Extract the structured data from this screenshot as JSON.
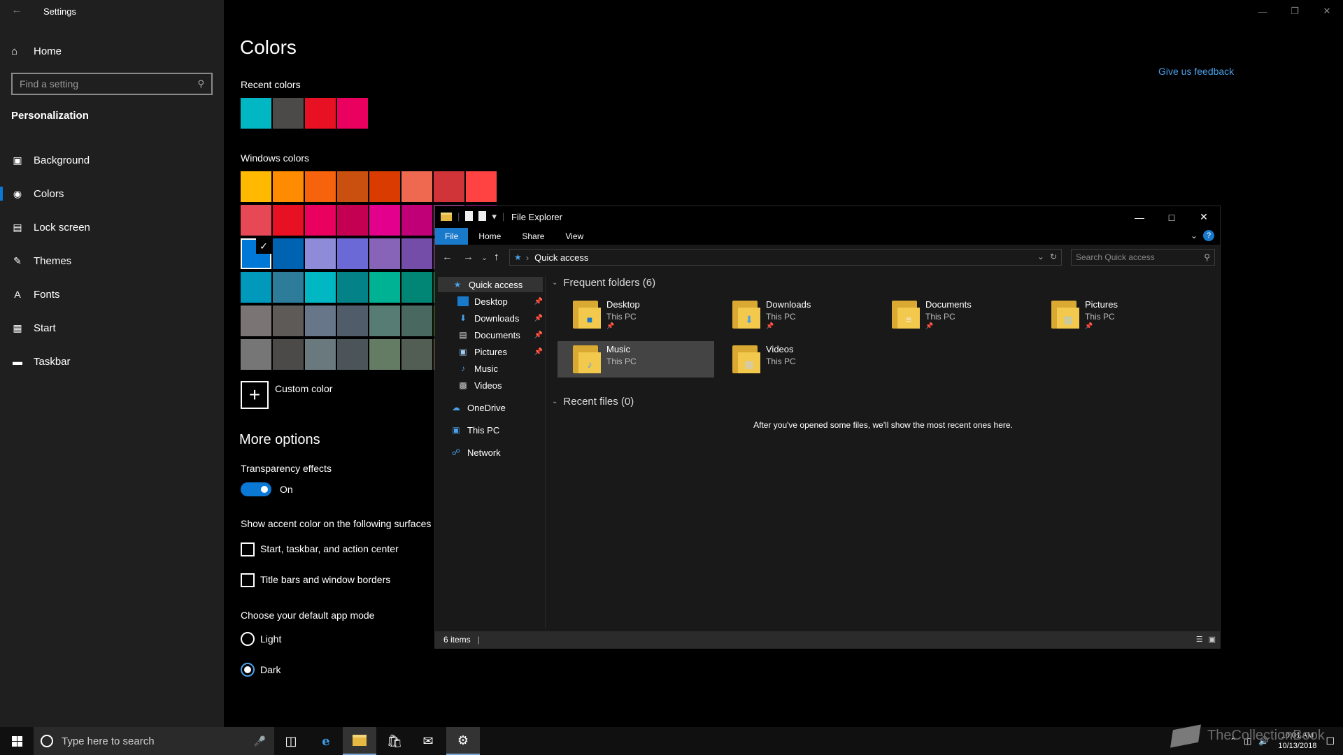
{
  "settings": {
    "app_title": "Settings",
    "home": "Home",
    "search_placeholder": "Find a setting",
    "section": "Personalization",
    "nav": [
      "Background",
      "Colors",
      "Lock screen",
      "Themes",
      "Fonts",
      "Start",
      "Taskbar"
    ],
    "active_nav": "Colors",
    "page_title": "Colors",
    "feedback": "Give us feedback",
    "recent_colors_label": "Recent colors",
    "recent_colors": [
      "#00b7c3",
      "#4c4a48",
      "#e81123",
      "#ea005e"
    ],
    "windows_colors_label": "Windows colors",
    "windows_colors": [
      [
        "#ffb900",
        "#ff8c00",
        "#f7630c",
        "#ca5010",
        "#da3b01",
        "#ef6950",
        "#d13438",
        "#ff4343"
      ],
      [
        "#e74856",
        "#e81123",
        "#ea005e",
        "#c30052",
        "#e3008c",
        "#bf0077",
        "#c239b3",
        "#9a0089"
      ],
      [
        "#0078d7",
        "#0063b1",
        "#8e8cd8",
        "#6b69d6",
        "#8764b8",
        "#744da9",
        "#b146c2",
        "#881798"
      ],
      [
        "#0099bc",
        "#2d7d9a",
        "#00b7c3",
        "#038387",
        "#00b294",
        "#018574",
        "#00cc6a",
        "#10893e"
      ],
      [
        "#7a7574",
        "#5d5a58",
        "#68768a",
        "#515c6b",
        "#567c73",
        "#486860",
        "#498205",
        "#107c10"
      ],
      [
        "#767676",
        "#4c4a48",
        "#69797e",
        "#4a5459",
        "#647c64",
        "#525e54",
        "#847545",
        "#7e735f"
      ]
    ],
    "custom_color": "Custom color",
    "more_options": "More options",
    "transparency_label": "Transparency effects",
    "transparency_state": "On",
    "accent_surfaces_label": "Show accent color on the following surfaces",
    "surface_start": "Start, taskbar, and action center",
    "surface_title": "Title bars and window borders",
    "app_mode_label": "Choose your default app mode",
    "mode_light": "Light",
    "mode_dark": "Dark"
  },
  "explorer": {
    "title": "File Explorer",
    "ribbon_tabs": [
      "File",
      "Home",
      "Share",
      "View"
    ],
    "address": "Quick access",
    "search_placeholder": "Search Quick access",
    "nav_pane": {
      "quick_access": "Quick access",
      "pinned": [
        "Desktop",
        "Downloads",
        "Documents",
        "Pictures"
      ],
      "unpinned": [
        "Music",
        "Videos"
      ],
      "onedrive": "OneDrive",
      "this_pc": "This PC",
      "network": "Network"
    },
    "frequent_header": "Frequent folders (6)",
    "folders": [
      {
        "name": "Desktop",
        "location": "This PC",
        "pinned": true
      },
      {
        "name": "Downloads",
        "location": "This PC",
        "pinned": true
      },
      {
        "name": "Documents",
        "location": "This PC",
        "pinned": true
      },
      {
        "name": "Pictures",
        "location": "This PC",
        "pinned": true
      },
      {
        "name": "Music",
        "location": "This PC",
        "pinned": false
      },
      {
        "name": "Videos",
        "location": "This PC",
        "pinned": false
      }
    ],
    "recent_header": "Recent files (0)",
    "empty_message": "After you've opened some files, we'll show the most recent ones here.",
    "status": "6 items"
  },
  "taskbar": {
    "search_placeholder": "Type here to search",
    "time": "10:01 AM",
    "date": "10/13/2018",
    "watermark": "TheCollectionBook"
  },
  "colors": {
    "accent": "#0078d7",
    "link": "#4ba0ea",
    "sidebar_bg": "#1f1f1f",
    "explorer_bg": "#191919"
  }
}
